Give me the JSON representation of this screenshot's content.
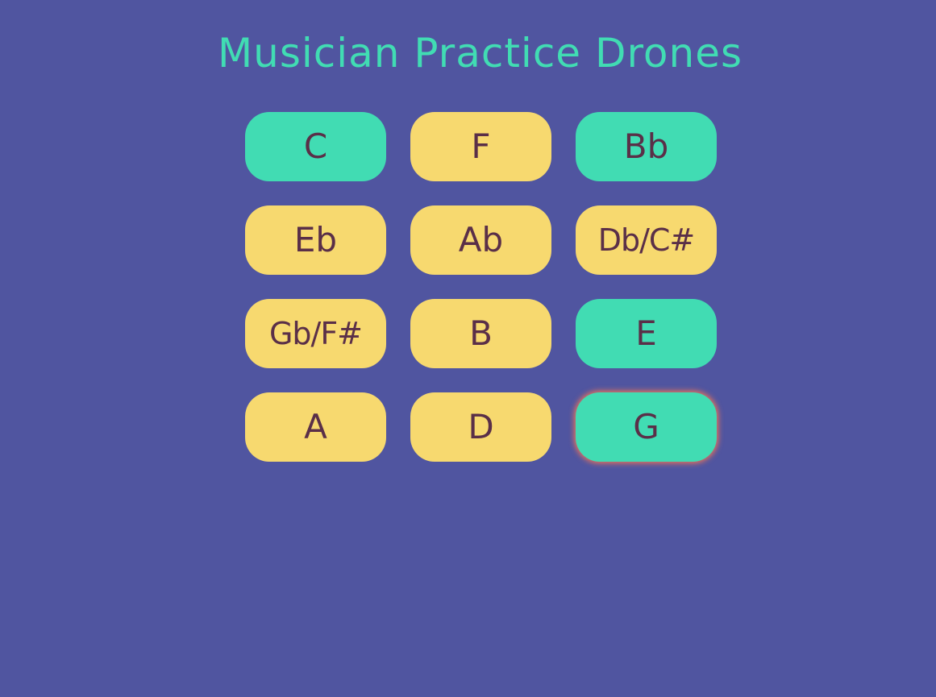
{
  "page": {
    "title": "Musician Practice Drones"
  },
  "colors": {
    "background": "#5055a0",
    "title": "#41dcb3",
    "active_button": "#41dcb3",
    "inactive_button": "#f7d96f",
    "button_text": "#5a2f48",
    "focus_glow": "#e8745a"
  },
  "drones": [
    {
      "label": "C",
      "active": true
    },
    {
      "label": "F",
      "active": false
    },
    {
      "label": "Bb",
      "active": true
    },
    {
      "label": "Eb",
      "active": false
    },
    {
      "label": "Ab",
      "active": false
    },
    {
      "label": "Db/C#",
      "active": false
    },
    {
      "label": "Gb/F#",
      "active": false
    },
    {
      "label": "B",
      "active": false
    },
    {
      "label": "E",
      "active": true
    },
    {
      "label": "A",
      "active": false
    },
    {
      "label": "D",
      "active": false
    },
    {
      "label": "G",
      "active": true,
      "focused": true
    }
  ]
}
